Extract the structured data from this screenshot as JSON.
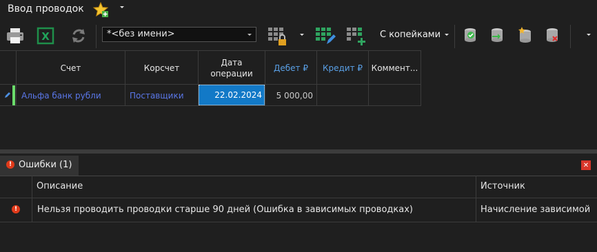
{
  "window": {
    "title": "Ввод проводок"
  },
  "toolbar": {
    "name_combo_value": "*<без имени>",
    "kopeiki_label": "С копейками",
    "icons": [
      "print-icon",
      "excel-export-icon",
      "refresh-icon",
      "grid-lock-icon",
      "grid-edit-icon",
      "grid-add-icon",
      "db-check-icon",
      "db-move-icon",
      "db-new-icon",
      "db-delete-icon"
    ]
  },
  "grid": {
    "columns": [
      {
        "label": "Счет"
      },
      {
        "label": "Корсчет"
      },
      {
        "label": "Дата\nоперации"
      },
      {
        "label": "Дебет ₽"
      },
      {
        "label": "Кредит ₽"
      },
      {
        "label": "Коммент..."
      }
    ],
    "rows": [
      {
        "schet": "Альфа банк рубли",
        "korschet": "Поставщики",
        "date": "22.02.2024",
        "debet": "5 000,00",
        "kredit": "",
        "comment": ""
      }
    ]
  },
  "errors": {
    "tab_label": "Ошибки (1)",
    "columns": {
      "description": "Описание",
      "source": "Источник"
    },
    "rows": [
      {
        "description": "Нельзя проводить проводки старше 90 дней (Ошибка в зависимых проводках)",
        "source": "Начисление зависимой"
      }
    ]
  },
  "colors": {
    "accent": "#1279c7",
    "link": "#5a77e8",
    "error": "#e03a1a",
    "row_marker": "#6bdc6b"
  }
}
